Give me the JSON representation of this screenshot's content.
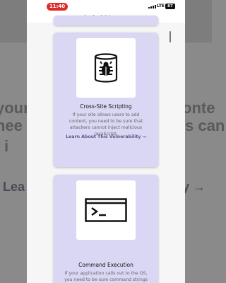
{
  "background": {
    "left_top": "your",
    "right_top": "onte",
    "left_mid": "nee",
    "right_mid": "s can",
    "left_bottom": "i",
    "left_link": "Lea",
    "right_link": "ty →"
  },
  "status_bar": {
    "time": "11:40",
    "network": "LTE",
    "battery": "87"
  },
  "browser": {
    "url": "hacksplaining.com"
  },
  "cards": [
    {
      "icon": "bug-database-icon",
      "title": "Cross-Site Scripting",
      "description": "If your site allows users to add content, you need to be sure that attackers cannot inject malicious JavaScript.",
      "link": "Learn About This Vulnerability →"
    },
    {
      "icon": "terminal-icon",
      "title": "Command Execution",
      "description": "If your application calls out to the OS, you need to be sure command strings are"
    }
  ]
}
